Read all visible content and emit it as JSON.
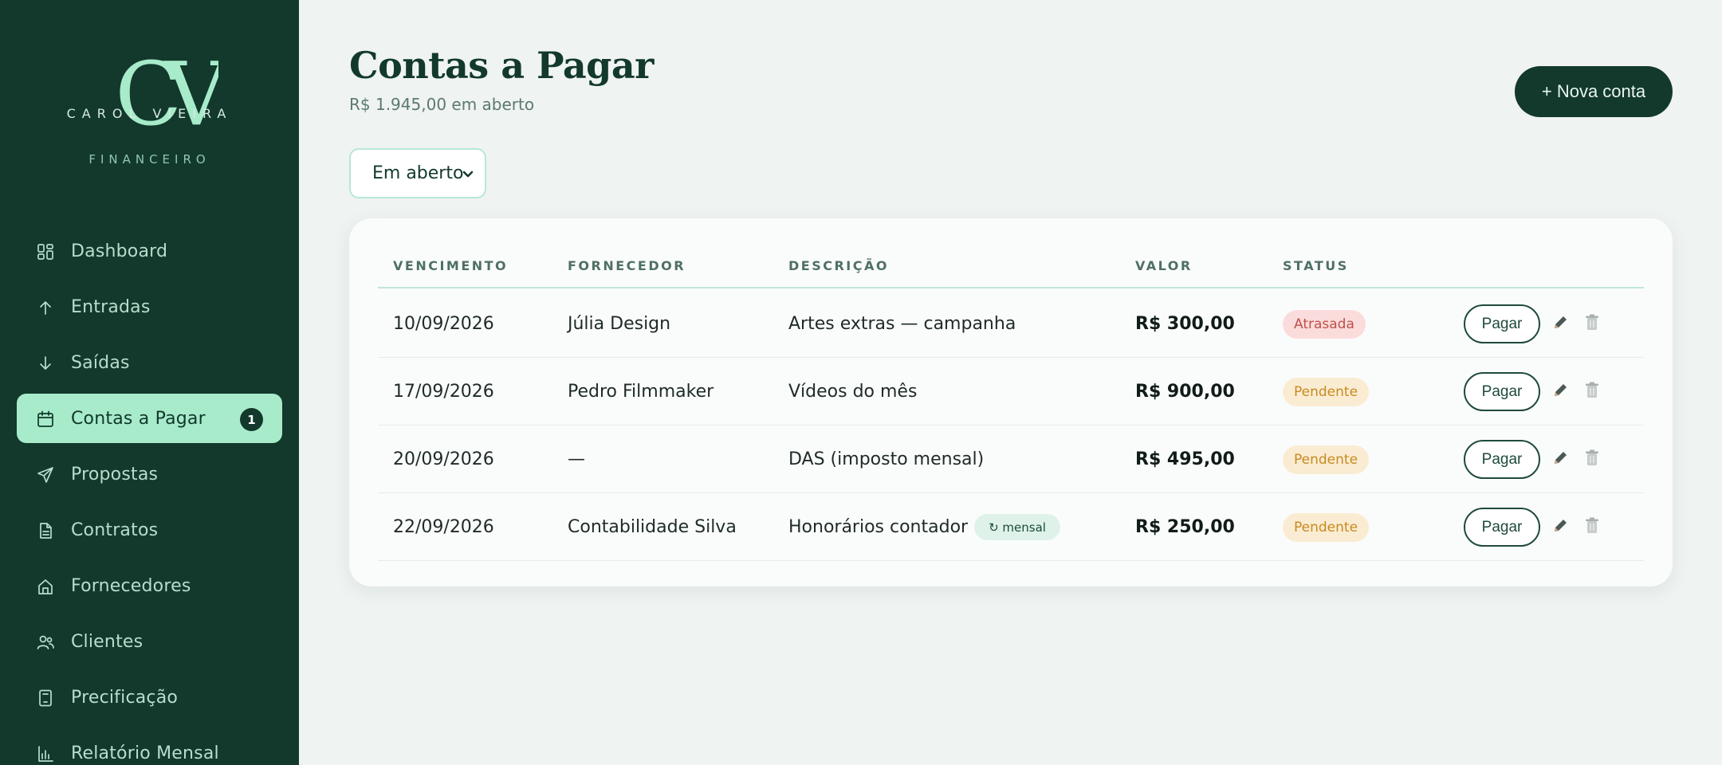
{
  "brand": {
    "monogram": "CV",
    "name": "CAROL VIEIRA",
    "subtitle": "FINANCEIRO"
  },
  "sidebar": {
    "items": [
      {
        "label": "Dashboard",
        "icon": "dashboard-icon"
      },
      {
        "label": "Entradas",
        "icon": "arrow-up-icon"
      },
      {
        "label": "Saídas",
        "icon": "arrow-down-icon"
      },
      {
        "label": "Contas a Pagar",
        "icon": "calendar-icon",
        "badge": "1",
        "active": true
      },
      {
        "label": "Propostas",
        "icon": "send-icon"
      },
      {
        "label": "Contratos",
        "icon": "document-icon"
      },
      {
        "label": "Fornecedores",
        "icon": "store-icon"
      },
      {
        "label": "Clientes",
        "icon": "users-icon"
      },
      {
        "label": "Precificação",
        "icon": "calculator-icon"
      },
      {
        "label": "Relatório Mensal",
        "icon": "bar-chart-icon"
      }
    ]
  },
  "header": {
    "title": "Contas a Pagar",
    "subtitle": "R$ 1.945,00 em aberto",
    "new_button": "+ Nova conta"
  },
  "filter": {
    "selected": "Em aberto"
  },
  "table": {
    "columns": [
      "VENCIMENTO",
      "FORNECEDOR",
      "DESCRIÇÃO",
      "VALOR",
      "STATUS"
    ],
    "pay_label": "Pagar",
    "rows": [
      {
        "due": "10/09/2026",
        "supplier": "Júlia Design",
        "description": "Artes extras — campanha",
        "tag": "",
        "value": "R$ 300,00",
        "status": "Atrasada",
        "status_kind": "late"
      },
      {
        "due": "17/09/2026",
        "supplier": "Pedro Filmmaker",
        "description": "Vídeos do mês",
        "tag": "",
        "value": "R$ 900,00",
        "status": "Pendente",
        "status_kind": "pending"
      },
      {
        "due": "20/09/2026",
        "supplier": "—",
        "description": "DAS (imposto mensal)",
        "tag": "",
        "value": "R$ 495,00",
        "status": "Pendente",
        "status_kind": "pending"
      },
      {
        "due": "22/09/2026",
        "supplier": "Contabilidade Silva",
        "description": "Honorários contador",
        "tag": "↻ mensal",
        "value": "R$ 250,00",
        "status": "Pendente",
        "status_kind": "pending"
      }
    ]
  },
  "colors": {
    "sidebar_bg": "#12392c",
    "accent": "#a8ebcb",
    "late": "#c0504a",
    "pending": "#c98a1f"
  }
}
